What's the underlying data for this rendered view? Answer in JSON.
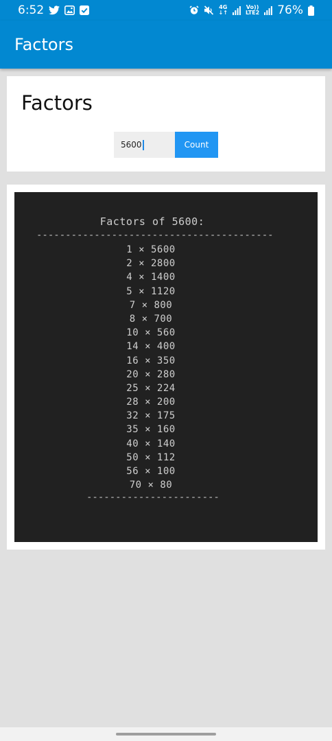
{
  "status_bar": {
    "time": "6:52",
    "battery": "76%",
    "network_4g": "4G",
    "volte": "Vo))",
    "lte2": "LTE2",
    "icons_left": [
      "twitter-icon",
      "gallery-icon",
      "check-box-icon"
    ],
    "icons_right": [
      "alarm-icon",
      "mute-icon",
      "signal-icon",
      "signal-icon",
      "battery-icon"
    ]
  },
  "app_bar": {
    "title": "Factors"
  },
  "form": {
    "title": "Factors",
    "input_value": "5600",
    "button_label": "Count"
  },
  "output": {
    "title": "Factors of 5600:",
    "rule_top": "--------------------------------------------",
    "rule_bottom": "----------------------------",
    "rows": [
      "1 × 5600",
      "2 × 2800",
      "4 × 1400",
      "5 × 1120",
      "7 × 800",
      "8 × 700",
      "10 × 560",
      "14 × 400",
      "16 × 350",
      "20 × 280",
      "25 × 224",
      "28 × 200",
      "32 × 175",
      "35 × 160",
      "40 × 140",
      "50 × 112",
      "56 × 100",
      "70 × 80"
    ]
  },
  "colors": {
    "primary": "#0288d1",
    "button": "#2196f3",
    "terminal_bg": "#212121",
    "page_bg": "#e0e0e0"
  }
}
